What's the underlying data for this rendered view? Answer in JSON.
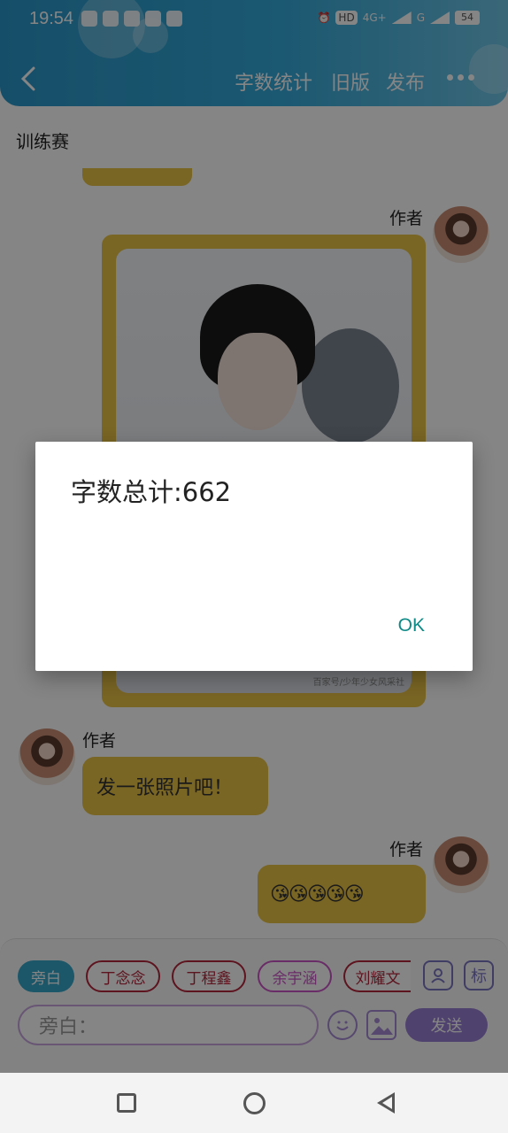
{
  "status_bar": {
    "time": "19:54",
    "network_label": "4G+",
    "network_label2": "G",
    "hd_label": "HD",
    "battery": "54"
  },
  "header": {
    "back_icon": "chevron-left-icon",
    "word_count_label": "字数统计",
    "old_version_label": "旧版",
    "publish_label": "发布",
    "more_icon": "more-dots-icon",
    "accent_color": "#34a9d9"
  },
  "content": {
    "title": "训练赛",
    "messages": [
      {
        "author": "作者",
        "type": "image",
        "watermark": "百家号/少年少女风采社"
      },
      {
        "author": "作者",
        "type": "text",
        "text": "发一张照片吧！"
      },
      {
        "author": "作者",
        "type": "emoji",
        "text": "😘😘😘😘😘"
      }
    ]
  },
  "input_panel": {
    "roles": [
      "旁白",
      "丁念念",
      "丁程鑫",
      "余宇涵",
      "刘耀文"
    ],
    "role_extra_icon": "标",
    "placeholder": "旁白：",
    "send_label": "发送"
  },
  "dialog": {
    "message": "字数总计:662",
    "ok_label": "OK",
    "ok_color": "#0e8a86"
  }
}
